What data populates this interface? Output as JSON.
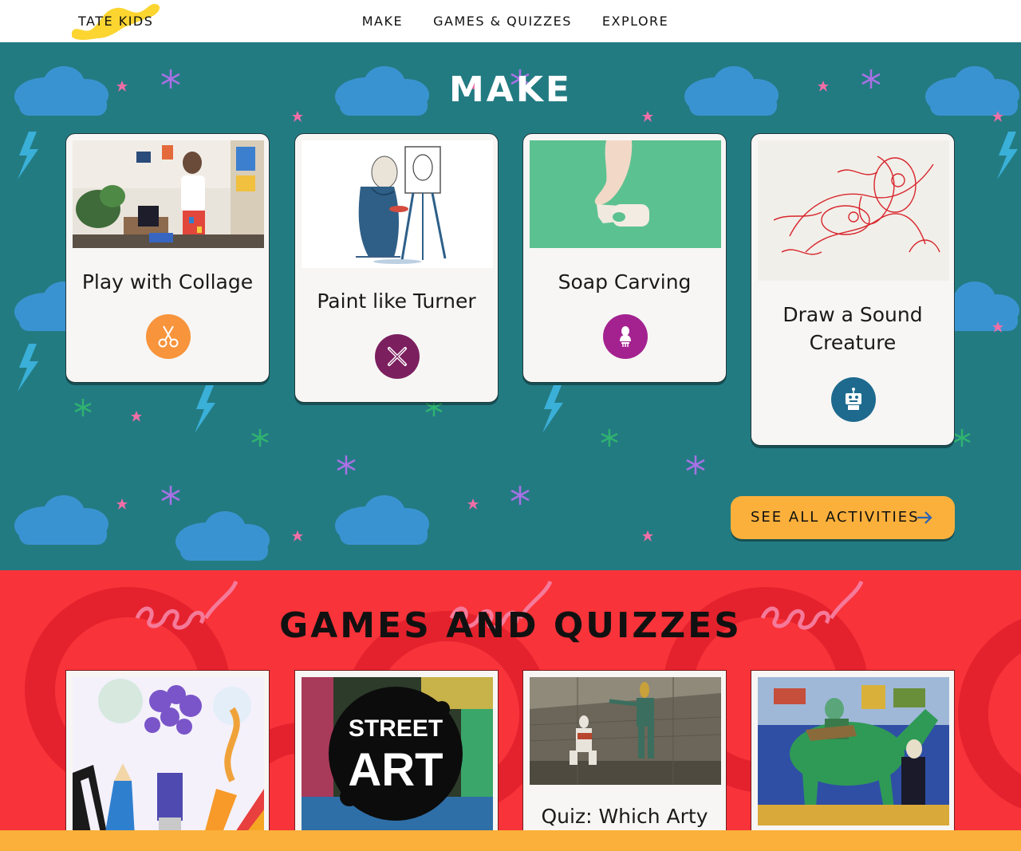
{
  "nav": {
    "logo": "TATE KIDS",
    "links": [
      "MAKE",
      "GAMES & QUIZZES",
      "EXPLORE"
    ]
  },
  "make": {
    "title": "MAKE",
    "cards": [
      {
        "title": "Play with Collage",
        "icon": "scissors-icon",
        "badge_color": "#f7943c"
      },
      {
        "title": "Paint like Turner",
        "icon": "paintbrush-pencil-icon",
        "badge_color": "#7b1f5f"
      },
      {
        "title": "Soap Carving",
        "icon": "bust-sculpture-icon",
        "badge_color": "#a3228f"
      },
      {
        "title_line1": "Draw a Sound",
        "title_line2": "Creature",
        "icon": "robot-icon",
        "badge_color": "#1e6a8e"
      }
    ],
    "cta": "SEE ALL ACTIVITIES"
  },
  "games": {
    "title": "GAMES AND QUIZZES",
    "cards": [
      {
        "image": "art-supplies-illustration"
      },
      {
        "image": "street-art",
        "image_text_1": "STREET",
        "image_text_2": "ART"
      },
      {
        "image": "dancers-photo",
        "title": "Quiz: Which Arty"
      },
      {
        "image": "green-donkey-painting"
      }
    ]
  },
  "colors": {
    "make_bg": "#237b82",
    "games_bg": "#f9333a",
    "cta": "#fbb03b",
    "cloud": "#3a93d1"
  }
}
